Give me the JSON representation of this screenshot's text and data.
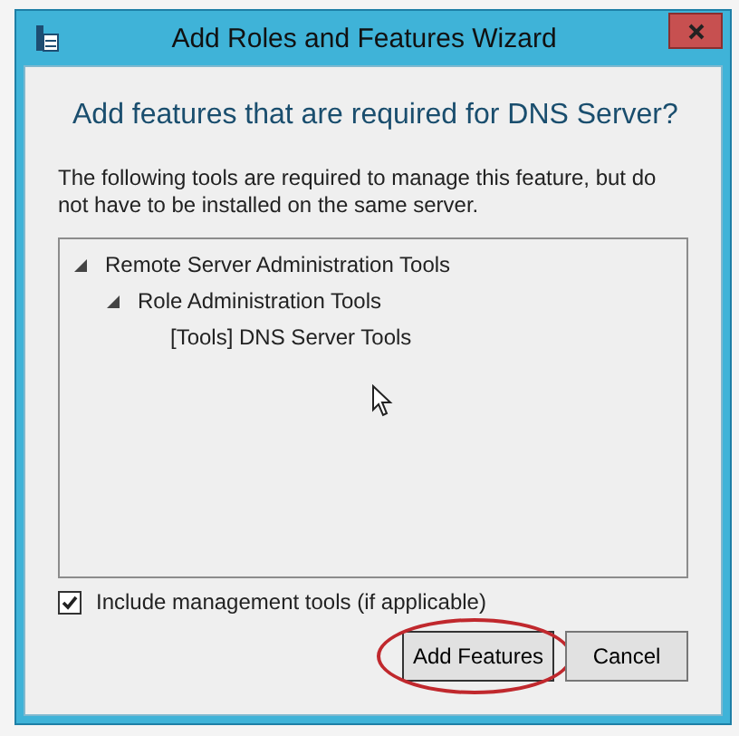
{
  "window": {
    "title": "Add Roles and Features Wizard"
  },
  "heading": "Add features that are required for DNS Server?",
  "description": "The following tools are required to manage this feature, but do not have to be installed on the same server.",
  "tree": [
    {
      "label": "Remote Server Administration Tools",
      "expanded": true,
      "children": [
        {
          "label": "Role Administration Tools",
          "expanded": true,
          "children": [
            {
              "label": "[Tools] DNS Server Tools"
            }
          ]
        }
      ]
    }
  ],
  "include_tools": {
    "label": "Include management tools (if applicable)",
    "checked": true
  },
  "buttons": [
    {
      "label": "Add Features",
      "highlighted": true
    },
    {
      "label": "Cancel",
      "highlighted": false
    }
  ]
}
